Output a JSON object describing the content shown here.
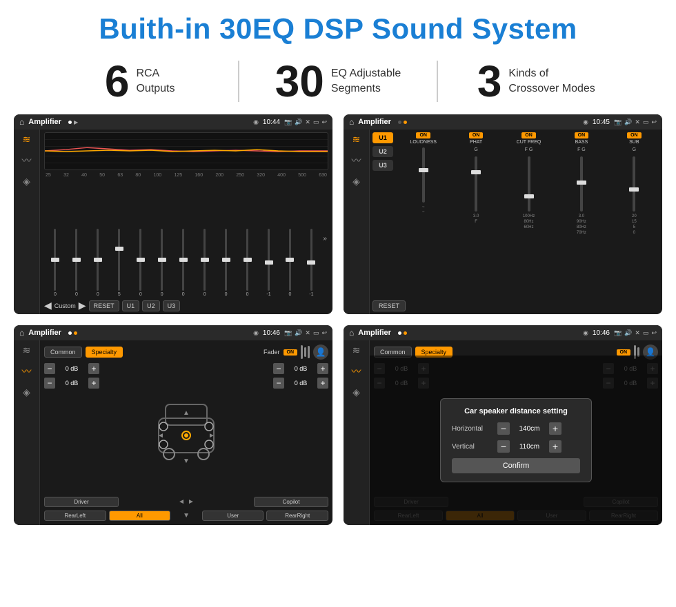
{
  "page": {
    "title": "Buith-in 30EQ DSP Sound System"
  },
  "stats": [
    {
      "number": "6",
      "text_line1": "RCA",
      "text_line2": "Outputs"
    },
    {
      "number": "30",
      "text_line1": "EQ Adjustable",
      "text_line2": "Segments"
    },
    {
      "number": "3",
      "text_line1": "Kinds of",
      "text_line2": "Crossover Modes"
    }
  ],
  "screen1": {
    "status": {
      "title": "Amplifier",
      "time": "10:44"
    },
    "freq_labels": [
      "25",
      "32",
      "40",
      "50",
      "63",
      "80",
      "100",
      "125",
      "160",
      "200",
      "250",
      "320",
      "400",
      "500",
      "630"
    ],
    "slider_vals": [
      "0",
      "0",
      "0",
      "5",
      "0",
      "0",
      "0",
      "0",
      "0",
      "0",
      "-1",
      "0",
      "-1"
    ],
    "bottom_btns": [
      "Custom",
      "RESET",
      "U1",
      "U2",
      "U3"
    ]
  },
  "screen2": {
    "status": {
      "title": "Amplifier",
      "time": "10:45"
    },
    "presets": [
      "U1",
      "U2",
      "U3"
    ],
    "channels": [
      {
        "on": true,
        "label": "LOUDNESS"
      },
      {
        "on": true,
        "label": "PHAT"
      },
      {
        "on": true,
        "label": "CUT FREQ"
      },
      {
        "on": true,
        "label": "BASS"
      },
      {
        "on": true,
        "label": "SUB"
      }
    ],
    "reset_label": "RESET"
  },
  "screen3": {
    "status": {
      "title": "Amplifier",
      "time": "10:46"
    },
    "tabs": [
      "Common",
      "Specialty"
    ],
    "fader_label": "Fader",
    "fader_on": "ON",
    "db_values": [
      "0 dB",
      "0 dB",
      "0 dB",
      "0 dB"
    ],
    "bottom_btns": [
      "Driver",
      "",
      "",
      "",
      "Copilot",
      "RearLeft",
      "All",
      "",
      "User",
      "RearRight"
    ]
  },
  "screen4": {
    "status": {
      "title": "Amplifier",
      "time": "10:46"
    },
    "tabs": [
      "Common",
      "Specialty"
    ],
    "dialog": {
      "title": "Car speaker distance setting",
      "horizontal_label": "Horizontal",
      "horizontal_value": "140cm",
      "vertical_label": "Vertical",
      "vertical_value": "110cm",
      "confirm_label": "Confirm"
    },
    "db_values": [
      "0 dB",
      "0 dB"
    ],
    "bottom_btns": [
      "Driver",
      "Copilot",
      "RearLeft",
      "All",
      "User",
      "RearRight"
    ]
  },
  "icons": {
    "home": "⌂",
    "location": "◉",
    "camera": "📷",
    "sound": "🔊",
    "close": "✕",
    "minimize": "—",
    "back": "↩",
    "eq": "≋",
    "wave": "〰",
    "speaker": "◈",
    "play": "▶",
    "prev": "◀",
    "next": "▶▶",
    "user": "👤",
    "chevron_down": "▼",
    "chevron_up": "▲",
    "chevron_left": "◄",
    "chevron_right": "►"
  }
}
